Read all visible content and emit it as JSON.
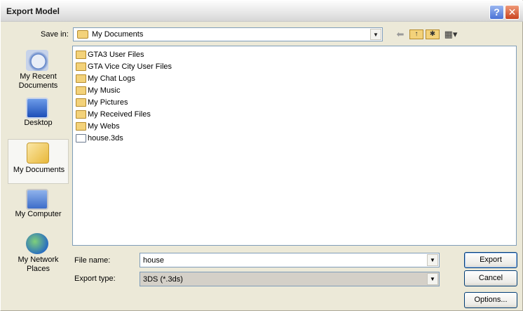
{
  "window": {
    "title": "Export Model"
  },
  "title_buttons": {
    "help": "?",
    "close": "✕"
  },
  "save_in": {
    "label": "Save in:",
    "value": "My Documents",
    "toolbar_icons": [
      "back-arrow-icon",
      "up-folder-icon",
      "new-folder-icon",
      "view-menu-icon"
    ]
  },
  "places": [
    {
      "label": "My Recent\nDocuments",
      "icon": "recent-documents-icon",
      "selected": false
    },
    {
      "label": "Desktop",
      "icon": "desktop-icon",
      "selected": false
    },
    {
      "label": "My Documents",
      "icon": "my-documents-icon",
      "selected": true
    },
    {
      "label": "My Computer",
      "icon": "my-computer-icon",
      "selected": false
    },
    {
      "label": "My Network\nPlaces",
      "icon": "network-places-icon",
      "selected": false
    }
  ],
  "files": [
    {
      "name": "GTA3 User Files",
      "type": "folder"
    },
    {
      "name": "GTA Vice City User Files",
      "type": "folder"
    },
    {
      "name": "My Chat Logs",
      "type": "folder"
    },
    {
      "name": "My Music",
      "type": "folder"
    },
    {
      "name": "My Pictures",
      "type": "folder"
    },
    {
      "name": "My Received Files",
      "type": "folder"
    },
    {
      "name": "My Webs",
      "type": "folder"
    },
    {
      "name": "house.3ds",
      "type": "file"
    }
  ],
  "file_name": {
    "label": "File name:",
    "value": "house"
  },
  "export_type": {
    "label": "Export type:",
    "value": "3DS (*.3ds)"
  },
  "buttons": {
    "export": "Export",
    "cancel": "Cancel",
    "options": "Options..."
  }
}
